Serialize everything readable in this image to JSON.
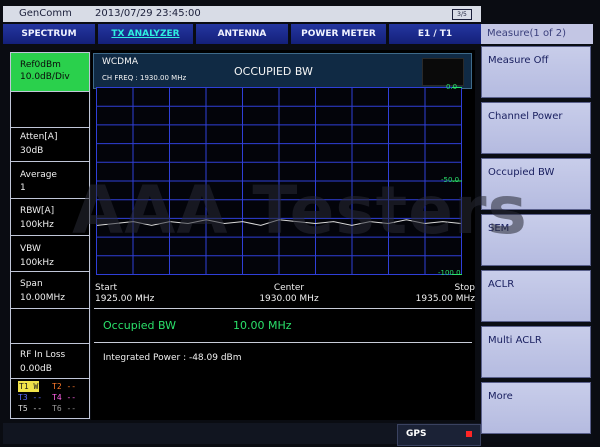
{
  "window": {
    "brand": "GenComm",
    "datetime": "2013/07/29 23:45:00",
    "battery": "3/5"
  },
  "tabs": [
    {
      "label": "SPECTRUM",
      "active": false
    },
    {
      "label": "TX ANALYZER",
      "active": true
    },
    {
      "label": "ANTENNA",
      "active": false
    },
    {
      "label": "POWER METER",
      "active": false
    },
    {
      "label": "E1 / T1",
      "active": false
    }
  ],
  "measure_menu": {
    "title": "Measure(1 of 2)",
    "items": [
      "Measure Off",
      "Channel Power",
      "Occupied BW",
      "SEM",
      "ACLR",
      "Multi ACLR",
      "More"
    ],
    "selected": "Occupied BW"
  },
  "left_panel": {
    "ref": "Ref0dBm",
    "scale": "10.0dB/Div",
    "atten_label": "Atten[A]",
    "atten_value": "30dB",
    "average_label": "Average",
    "average_value": "1",
    "rbw_label": "RBW[A]",
    "rbw_value": "100kHz",
    "vbw_label": "VBW",
    "vbw_value": "100kHz",
    "span_label": "Span",
    "span_value": "10.00MHz",
    "rfloss_label": "RF In Loss",
    "rfloss_value": "0.00dB",
    "traces": [
      {
        "name": "T1",
        "state": "W",
        "color": "#f0e24a"
      },
      {
        "name": "T2",
        "state": "--",
        "color": "#ff7a2a"
      },
      {
        "name": "T3",
        "state": "--",
        "color": "#5a6bff"
      },
      {
        "name": "T4",
        "state": "--",
        "color": "#ff62e8"
      },
      {
        "name": "T5",
        "state": "--",
        "color": "#d8d8d8"
      },
      {
        "name": "T6",
        "state": "--",
        "color": "#9a9a9a"
      }
    ]
  },
  "display": {
    "standard": "WCDMA",
    "ch_freq": "CH FREQ : 1930.00 MHz",
    "mode": "OCCUPIED BW",
    "ref_top": "0.0",
    "ref_mid": "-50.0",
    "ref_bottom": "-100.0",
    "start_label": "Start",
    "start_value": "1925.00 MHz",
    "center_label": "Center",
    "center_value": "1930.00 MHz",
    "stop_label": "Stop",
    "stop_value": "1935.00 MHz",
    "occupied_bw_label": "Occupied BW",
    "occupied_bw_value": "10.00 MHz",
    "integrated_power": "Integrated Power : -48.09 dBm"
  },
  "gps": {
    "label": "GPS"
  },
  "watermark": "AAA Testers",
  "colors": {
    "grid": "#2f3fd8",
    "trace": "#d9d9d9",
    "reference": "#2ae06a",
    "tab": "#1b2a8e",
    "softkey": "#c3c8e6"
  },
  "chart_data": {
    "type": "line",
    "x_range_mhz": [
      1925,
      1935
    ],
    "ylim": [
      -100,
      0
    ],
    "unit": "dBm",
    "series": [
      {
        "x": [
          1925,
          1925.5,
          1926,
          1926.5,
          1927,
          1927.5,
          1928,
          1928.5,
          1929,
          1929.5,
          1930,
          1930.5,
          1931,
          1931.5,
          1932,
          1932.5,
          1933,
          1933.5,
          1934,
          1934.5,
          1935
        ],
        "y": [
          -74,
          -73,
          -72,
          -74,
          -72,
          -73,
          -71,
          -73,
          -72,
          -74,
          -71,
          -72,
          -73,
          -72,
          -74,
          -72,
          -73,
          -71,
          -73,
          -72,
          -73
        ]
      }
    ]
  }
}
